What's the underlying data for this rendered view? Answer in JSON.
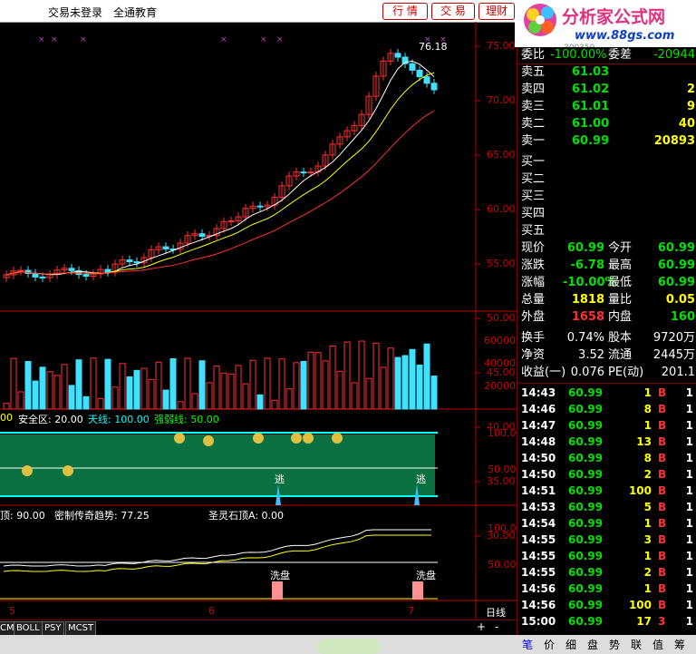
{
  "topbar": {
    "nav1": "交易未登录",
    "nav2": "全通教育",
    "btn_quotes": "行 情",
    "btn_trade": "交 易",
    "btn_finance": "理财"
  },
  "logo": {
    "text": "分析家公式网",
    "url_text": "www.88gs.com",
    "stock_code_fragment": "300359"
  },
  "price_axis": [
    "75.00",
    "70.00",
    "65.00",
    "60.00",
    "55.00",
    "50.00",
    "45.00",
    "40.00",
    "35.00",
    "30.00"
  ],
  "price_high_label": "76.18",
  "volume_axis": [
    "60000",
    "40000",
    "20000"
  ],
  "indicator1": {
    "label_a": "00",
    "label_b": "安全区: 20.00",
    "label_c": "天线: 100.00",
    "label_d": "强弱线: 50.00",
    "axis": [
      "100.0",
      "50.00"
    ],
    "escape_label": "逃"
  },
  "indicator2": {
    "label_a": "顶: 90.00",
    "label_b": "密制传奇趋势: 77.25",
    "label_c": "圣灵石顶A: 0.00",
    "axis": [
      "100.0",
      "50.00"
    ],
    "wash_label": "洗盘"
  },
  "x_axis": [
    "5",
    "6",
    "7"
  ],
  "period_label": "日线",
  "bottom_tabs": [
    "CM",
    "BOLL",
    "PSY",
    "MCST"
  ],
  "zoom": {
    "plus": "+",
    "minus": "-"
  },
  "quote": {
    "ratio_label": "委比",
    "ratio_value": "-100.00%",
    "diff_label": "委差",
    "diff_value": "-20944",
    "asks": [
      {
        "label": "卖五",
        "price": "61.03",
        "vol": ""
      },
      {
        "label": "卖四",
        "price": "61.02",
        "vol": "2"
      },
      {
        "label": "卖三",
        "price": "61.01",
        "vol": "9"
      },
      {
        "label": "卖二",
        "price": "61.00",
        "vol": "40"
      },
      {
        "label": "卖一",
        "price": "60.99",
        "vol": "20893"
      }
    ],
    "bids": [
      {
        "label": "买一"
      },
      {
        "label": "买二"
      },
      {
        "label": "买三"
      },
      {
        "label": "买四"
      },
      {
        "label": "买五"
      }
    ],
    "stats": [
      {
        "l1": "现价",
        "v1": "60.99",
        "l2": "今开",
        "v2": "60.99",
        "c1": "#00e000",
        "c2": "#00e000"
      },
      {
        "l1": "涨跌",
        "v1": "-6.78",
        "l2": "最高",
        "v2": "60.99",
        "c1": "#00e000",
        "c2": "#00e000"
      },
      {
        "l1": "涨幅",
        "v1": "-10.00%",
        "l2": "最低",
        "v2": "60.99",
        "c1": "#00e000",
        "c2": "#00e000"
      },
      {
        "l1": "总量",
        "v1": "1818",
        "l2": "量比",
        "v2": "0.05",
        "c1": "#ffff00",
        "c2": "#ffff00"
      },
      {
        "l1": "外盘",
        "v1": "1658",
        "l2": "内盘",
        "v2": "160",
        "c1": "#ff3030",
        "c2": "#00e000"
      }
    ],
    "fin": [
      {
        "l1": "换手",
        "v1": "0.74%",
        "l2": "股本",
        "v2": "9720万"
      },
      {
        "l1": "净资",
        "v1": "3.52",
        "l2": "流通",
        "v2": "2445万"
      },
      {
        "l1": "收益(一)",
        "v1": "0.076",
        "l2": "PE(动)",
        "v2": "201.1"
      }
    ],
    "ticks": [
      {
        "t": "14:43",
        "p": "60.99",
        "v": "1",
        "s": "B",
        "n": "1"
      },
      {
        "t": "14:46",
        "p": "60.99",
        "v": "8",
        "s": "B",
        "n": "1"
      },
      {
        "t": "14:47",
        "p": "60.99",
        "v": "1",
        "s": "B",
        "n": "1"
      },
      {
        "t": "14:48",
        "p": "60.99",
        "v": "13",
        "s": "B",
        "n": "1"
      },
      {
        "t": "14:50",
        "p": "60.99",
        "v": "8",
        "s": "B",
        "n": "1"
      },
      {
        "t": "14:50",
        "p": "60.99",
        "v": "2",
        "s": "B",
        "n": "1"
      },
      {
        "t": "14:51",
        "p": "60.99",
        "v": "100",
        "s": "B",
        "n": "1"
      },
      {
        "t": "14:53",
        "p": "60.99",
        "v": "5",
        "s": "B",
        "n": "1"
      },
      {
        "t": "14:54",
        "p": "60.99",
        "v": "1",
        "s": "B",
        "n": "1"
      },
      {
        "t": "14:55",
        "p": "60.99",
        "v": "3",
        "s": "B",
        "n": "1"
      },
      {
        "t": "14:55",
        "p": "60.99",
        "v": "1",
        "s": "B",
        "n": "1"
      },
      {
        "t": "14:55",
        "p": "60.99",
        "v": "2",
        "s": "B",
        "n": "1"
      },
      {
        "t": "14:56",
        "p": "60.99",
        "v": "1",
        "s": "B",
        "n": "1"
      },
      {
        "t": "14:56",
        "p": "60.99",
        "v": "100",
        "s": "B",
        "n": "1"
      },
      {
        "t": "15:00",
        "p": "60.99",
        "v": "17",
        "s": "3",
        "n": "1"
      }
    ]
  },
  "quote_tabs": [
    "笔",
    "价",
    "细",
    "盘",
    "势",
    "联",
    "值",
    "筹"
  ],
  "colors": {
    "up": "#ff3030",
    "down": "#40e0ff",
    "ma5": "#ffffff",
    "ma10": "#ffff00",
    "ma20": "#ff3030",
    "grid": "#8b0000",
    "axis": "#c00000"
  }
}
